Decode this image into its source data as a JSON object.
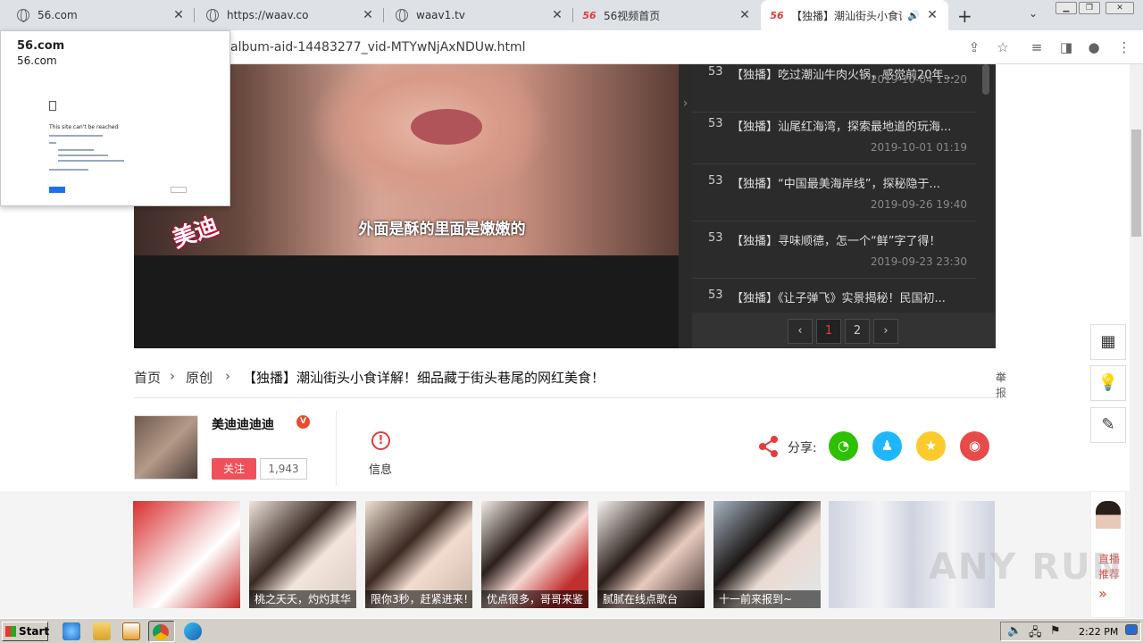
{
  "tabs": [
    {
      "title": "56.com",
      "icon": "globe-icon"
    },
    {
      "title": "https://waav.co",
      "icon": "globe-icon"
    },
    {
      "title": "waav1.tv",
      "icon": "globe-icon"
    },
    {
      "title": "56视频首页",
      "icon": "56-logo-icon"
    },
    {
      "title": "【独播】潮汕街头小食详解",
      "icon": "56-logo-icon"
    }
  ],
  "favicon_text": "56",
  "address_bar": {
    "url": "album-aid-14483277_vid-MTYwNjAxNDUw.html"
  },
  "popup": {
    "title": "56.com",
    "host": "56.com",
    "error_title": "This site can't be reached"
  },
  "video": {
    "subtitle": "外面是酥的里面是嫩嫩的",
    "watermark": "美迪"
  },
  "playlist": {
    "items": [
      {
        "num": "53",
        "title": "【独播】吃过潮汕牛肉火锅，感觉前20年...",
        "date": "2019-10-04 13:20"
      },
      {
        "num": "53",
        "title": "【独播】汕尾红海湾，探索最地道的玩海...",
        "date": "2019-10-01 01:19"
      },
      {
        "num": "53",
        "title": "【独播】“中国最美海岸线”，探秘隐于...",
        "date": "2019-09-26 19:40"
      },
      {
        "num": "53",
        "title": "【独播】寻味顺德，怎一个“鲜”字了得！",
        "date": "2019-09-23 23:30"
      },
      {
        "num": "53",
        "title": "【独播】《让子弹飞》实景揭秘！民国初...",
        "date": ""
      }
    ],
    "pager": {
      "prev": "‹",
      "pages": [
        "1",
        "2"
      ],
      "next": "›",
      "current": "1"
    }
  },
  "breadcrumb": {
    "home": "首页",
    "category": "原创",
    "title": "【独播】潮汕街头小食详解！细品藏于街头巷尾的网红美食！",
    "report": "举报"
  },
  "uploader": {
    "name": "美迪迪迪迪",
    "badge": "V",
    "follow_label": "关注",
    "followers": "1,943"
  },
  "info_label": "信息",
  "share": {
    "label": "分享:",
    "targets": [
      "wechat-icon",
      "qq-icon",
      "qzone-icon",
      "weibo-icon"
    ]
  },
  "recommend": [
    {
      "caption": ""
    },
    {
      "caption": "桃之夭夭，灼灼其华"
    },
    {
      "caption": "限你3秒，赶紧进来！"
    },
    {
      "caption": "优点很多，哥哥来鉴"
    },
    {
      "caption": "腻腻在线点歌台"
    },
    {
      "caption": "十一前来报到~"
    },
    {
      "caption": ""
    }
  ],
  "side_rail": {
    "live_label_1": "直播",
    "live_label_2": "推荐",
    "more": "»"
  },
  "watermark_overlay": "ANY RUN",
  "taskbar": {
    "start_label": "Start",
    "time": "2:22 PM"
  },
  "colors": {
    "brand_red": "#e73a3a",
    "wechat": "#2dc100",
    "qq": "#1fb6ff",
    "qzone": "#fbcb2b",
    "weibo": "#e84a4a"
  }
}
